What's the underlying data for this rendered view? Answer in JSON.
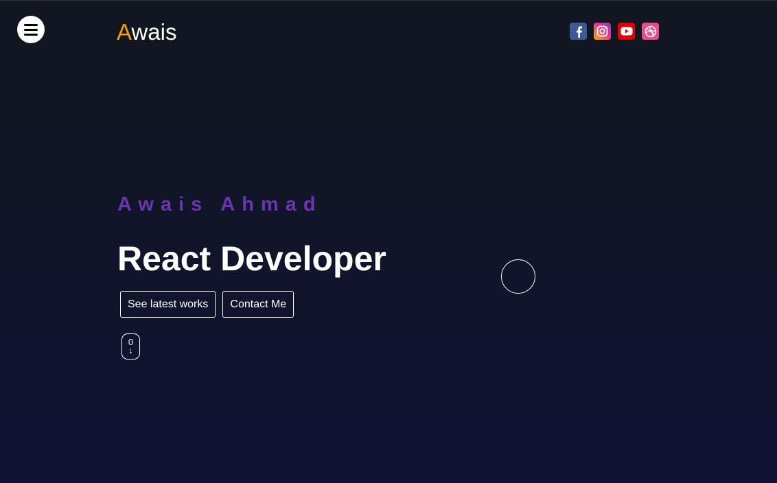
{
  "header": {
    "menu_icon": "hamburger-icon",
    "logo": {
      "accent": "A",
      "rest": "wais",
      "accent_color": "#f5a100"
    },
    "socials": [
      {
        "icon": "facebook-icon",
        "color": "#3d5a98"
      },
      {
        "icon": "instagram-icon",
        "color": "#e6398b"
      },
      {
        "icon": "youtube-icon",
        "color": "#e10008"
      },
      {
        "icon": "dribbble-icon",
        "color": "#ea4c89"
      }
    ]
  },
  "hero": {
    "name": "Awais Ahmad",
    "name_color": "#6a36b0",
    "title": "React Developer",
    "buttons": {
      "works": "See latest works",
      "contact": "Contact Me"
    },
    "scroll_indicator": {
      "digit": "0",
      "arrow": "↓"
    }
  }
}
